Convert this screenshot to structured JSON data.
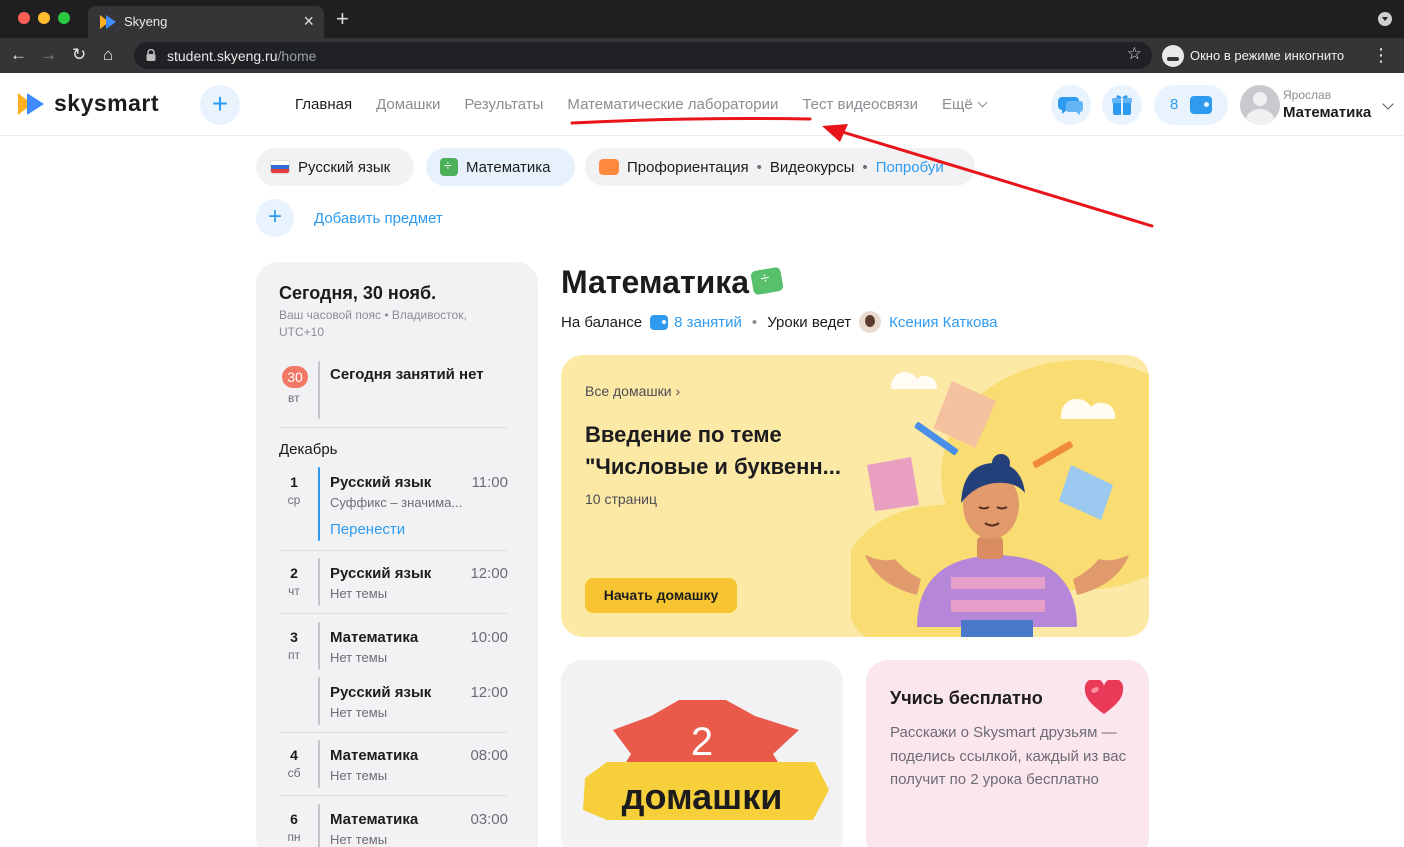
{
  "browser": {
    "tab_title": "Skyeng",
    "tab_close": "×",
    "new_tab": "+",
    "url_host": "student.skyeng.ru",
    "url_path": "/home",
    "incognito_label": "Окно в режиме инкогнито",
    "nav": {
      "back": "←",
      "forward": "→",
      "reload": "↻",
      "home": "⌂",
      "star": "☆",
      "menu": "⋮"
    }
  },
  "header": {
    "logo_text": "skysmart",
    "add_button": "+",
    "nav_items": [
      "Главная",
      "Домашки",
      "Результаты",
      "Математические лаборатории",
      "Тест видеосвязи",
      "Ещё"
    ],
    "active_nav": "Главная",
    "balance_count": "8",
    "user_name": "Ярослав",
    "user_subject": "Математика"
  },
  "subjects": {
    "chips": [
      {
        "label": "Русский язык",
        "icon": "russia-flag-icon"
      },
      {
        "label": "Математика",
        "icon": "math-icon"
      }
    ],
    "prof": {
      "label": "Профориентация",
      "extra": "Видеокурсы",
      "try": "Попробуй",
      "separator": "•"
    },
    "add_label": "Добавить предмет",
    "add_button": "+"
  },
  "schedule": {
    "title": "Сегодня, 30 нояб.",
    "timezone": "Ваш часовой пояс • Владивосток, UTC+10",
    "today": {
      "day": "30",
      "dow": "вт",
      "text": "Сегодня занятий нет"
    },
    "month": "Декабрь",
    "days": [
      {
        "day": "1",
        "dow": "ср",
        "lessons": [
          {
            "subject": "Русский язык",
            "time": "11:00",
            "topic": "Суффикс – значима...",
            "action": "Перенести"
          }
        ]
      },
      {
        "day": "2",
        "dow": "чт",
        "lessons": [
          {
            "subject": "Русский язык",
            "time": "12:00",
            "topic": "Нет темы"
          }
        ]
      },
      {
        "day": "3",
        "dow": "пт",
        "lessons": [
          {
            "subject": "Математика",
            "time": "10:00",
            "topic": "Нет темы"
          },
          {
            "subject": "Русский язык",
            "time": "12:00",
            "topic": "Нет темы"
          }
        ]
      },
      {
        "day": "4",
        "dow": "сб",
        "lessons": [
          {
            "subject": "Математика",
            "time": "08:00",
            "topic": "Нет темы"
          }
        ]
      },
      {
        "day": "6",
        "dow": "пн",
        "lessons": [
          {
            "subject": "Математика",
            "time": "03:00",
            "topic": "Нет темы"
          }
        ]
      }
    ]
  },
  "main": {
    "title": "Математика",
    "balance_label": "На балансе",
    "balance_value": "8 занятий",
    "separator": "•",
    "teacher_label": "Уроки ведет",
    "teacher_name": "Ксения Каткова",
    "homework_card": {
      "all_link": "Все домашки ›",
      "title": "Введение по теме \"Числовые и буквенн...",
      "pages": "10 страниц",
      "button": "Начать домашку"
    },
    "homework_count": {
      "number": "2",
      "label": "домашки"
    },
    "promo": {
      "title": "Учись бесплатно",
      "text": "Расскажи о Skysmart друзьям — поделись ссылкой, каждый из вас получит по 2 урока бесплатно"
    }
  },
  "colors": {
    "accent": "#2e9bf0",
    "homework_card_bg": "#fde9a6",
    "button_yellow": "#f7c531",
    "annotation_red": "#e8141a",
    "badge_red": "#f07864",
    "promo_bg": "#fce6ee"
  }
}
